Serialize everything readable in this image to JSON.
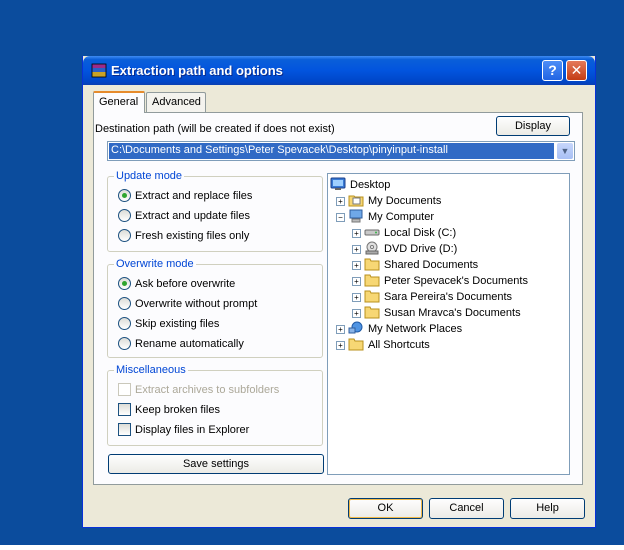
{
  "window": {
    "title": "Extraction path and options",
    "help_glyph": "?",
    "close_glyph": "✕"
  },
  "tabs": [
    {
      "label": "General",
      "active": true
    },
    {
      "label": "Advanced",
      "active": false
    }
  ],
  "destination": {
    "label": "Destination path (will be created if does not exist)",
    "display_button": "Display",
    "value": "C:\\Documents and Settings\\Peter Spevacek\\Desktop\\pinyinput-install"
  },
  "update_mode": {
    "title": "Update mode",
    "options": [
      {
        "label": "Extract and replace files",
        "selected": true
      },
      {
        "label": "Extract and update files",
        "selected": false
      },
      {
        "label": "Fresh existing files only",
        "selected": false
      }
    ]
  },
  "overwrite_mode": {
    "title": "Overwrite mode",
    "options": [
      {
        "label": "Ask before overwrite",
        "selected": true
      },
      {
        "label": "Overwrite without prompt",
        "selected": false
      },
      {
        "label": "Skip existing files",
        "selected": false
      },
      {
        "label": "Rename automatically",
        "selected": false
      }
    ]
  },
  "miscellaneous": {
    "title": "Miscellaneous",
    "options": [
      {
        "label": "Extract archives to subfolders",
        "checked": false,
        "disabled": true
      },
      {
        "label": "Keep broken files",
        "checked": false,
        "disabled": false
      },
      {
        "label": "Display files in Explorer",
        "checked": false,
        "disabled": false
      }
    ]
  },
  "save_settings": "Save settings",
  "tree": [
    {
      "label": "Desktop",
      "icon": "desktop-icon",
      "expander": ""
    },
    {
      "label": "My Documents",
      "icon": "my-documents-icon",
      "expander": "+"
    },
    {
      "label": "My Computer",
      "icon": "my-computer-icon",
      "expander": "−"
    },
    {
      "label": "Local Disk (C:)",
      "icon": "hard-disk-icon",
      "expander": "+"
    },
    {
      "label": "DVD Drive (D:)",
      "icon": "dvd-drive-icon",
      "expander": "+"
    },
    {
      "label": "Shared Documents",
      "icon": "folder-icon",
      "expander": "+"
    },
    {
      "label": "Peter Spevacek's Documents",
      "icon": "folder-icon",
      "expander": "+"
    },
    {
      "label": "Sara Pereira's Documents",
      "icon": "folder-icon",
      "expander": "+"
    },
    {
      "label": "Susan Mravca's Documents",
      "icon": "folder-icon",
      "expander": "+"
    },
    {
      "label": "My Network Places",
      "icon": "network-places-icon",
      "expander": "+"
    },
    {
      "label": "All Shortcuts",
      "icon": "folder-icon",
      "expander": "+"
    }
  ],
  "buttons": {
    "ok": "OK",
    "cancel": "Cancel",
    "help": "Help"
  },
  "colors": {
    "desktop": "#0b4c9d",
    "titlebar": "#0254de",
    "selection": "#316ac5",
    "group_title": "#0046d5"
  }
}
